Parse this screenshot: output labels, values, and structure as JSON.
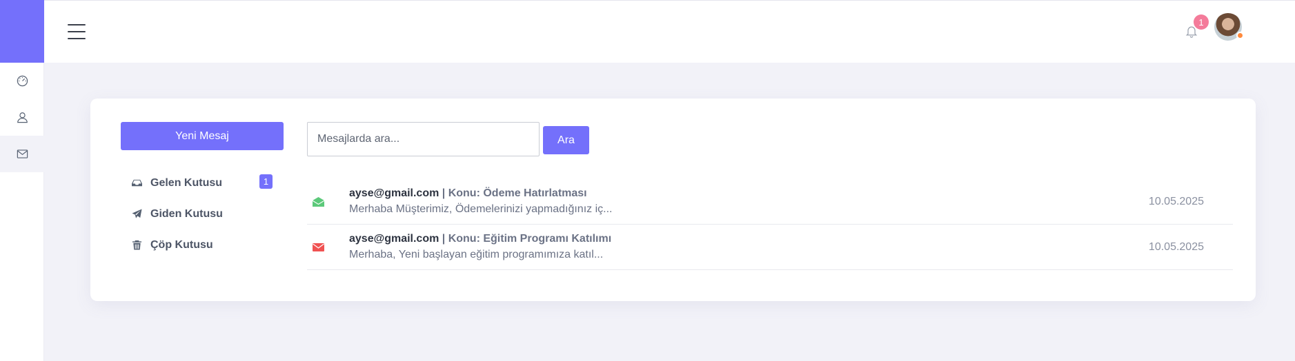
{
  "header": {
    "notification_count": "1"
  },
  "sidebar": {
    "items": [
      {
        "name": "dashboard",
        "icon": "speedometer-icon"
      },
      {
        "name": "profile",
        "icon": "user-icon"
      },
      {
        "name": "messages",
        "icon": "mail-icon",
        "active": true
      }
    ]
  },
  "mailbox": {
    "new_message_label": "Yeni Mesaj",
    "folders": [
      {
        "label": "Gelen Kutusu",
        "icon": "inbox-icon",
        "count": "1"
      },
      {
        "label": "Giden Kutusu",
        "icon": "paper-plane-icon"
      },
      {
        "label": "Çöp Kutusu",
        "icon": "trash-icon"
      }
    ]
  },
  "search": {
    "placeholder": "Mesajlarda ara...",
    "value": "",
    "button_label": "Ara"
  },
  "messages": [
    {
      "sender": "ayse@gmail.com",
      "subject": " | Konu: Ödeme Hatırlatması",
      "preview": "Merhaba Müşterimiz, Ödemelerinizi yapmadığınız iç...",
      "date": "10.05.2025",
      "status": "read",
      "icon": "envelope-open-icon",
      "icon_color": "#5cc97a"
    },
    {
      "sender": "ayse@gmail.com",
      "subject": " | Konu: Eğitim Programı Katılımı",
      "preview": "Merhaba, Yeni başlayan eğitim programımıza katıl...",
      "date": "10.05.2025",
      "status": "unread",
      "icon": "envelope-icon",
      "icon_color": "#f05252"
    }
  ],
  "colors": {
    "accent": "#7470fb",
    "badge": "#f47b9a",
    "background": "#f2f2f8"
  }
}
